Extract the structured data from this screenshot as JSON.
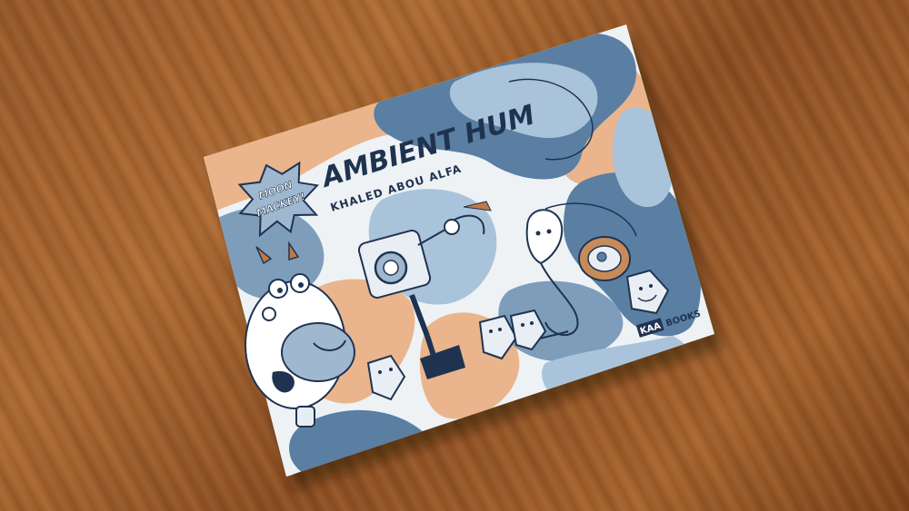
{
  "book": {
    "title": "AMBIENT HUM",
    "author": "KHALED ABOU ALFA",
    "series_badge_line1": "MOON",
    "series_badge_line2": "MACKEY!",
    "publisher_box": "KAA",
    "publisher_name": "BOOKS"
  },
  "colors": {
    "wood": "#a0602c",
    "cover_blue": "#5a7fa3",
    "cover_light_blue": "#a9c3da",
    "cover_peach": "#eab58c",
    "cover_white": "#eef2f5",
    "ink_navy": "#1f3350"
  }
}
